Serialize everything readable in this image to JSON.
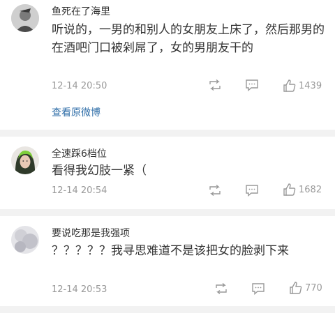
{
  "comments": [
    {
      "username": "鱼死在了海里",
      "text": "听说的，一男的和别人的女朋友上床了，然后那男的在酒吧门口被剁屌了，女的男朋友干的",
      "time": "12-14 20:50",
      "likes": "1439",
      "link": "查看原微博",
      "avatar": "avatar-gray-figure"
    },
    {
      "username": "全速踩6档位",
      "text": "看得我幻肢一紧（",
      "time": "12-14 20:54",
      "likes": "1682",
      "avatar": "avatar-green-hair-portrait"
    },
    {
      "username": "要说吃那是我强项",
      "text": "？？？？？我寻思难道不是该把女的脸剥下来",
      "time": "12-14 20:53",
      "likes": "770",
      "avatar": "avatar-light-blurred"
    }
  ],
  "icons": {
    "repost": "repost-icon",
    "comment": "comment-icon",
    "like": "thumbs-up-icon"
  },
  "colors": {
    "link": "#2f6ea8",
    "meta": "#999999",
    "divider": "#f2f2f2"
  }
}
